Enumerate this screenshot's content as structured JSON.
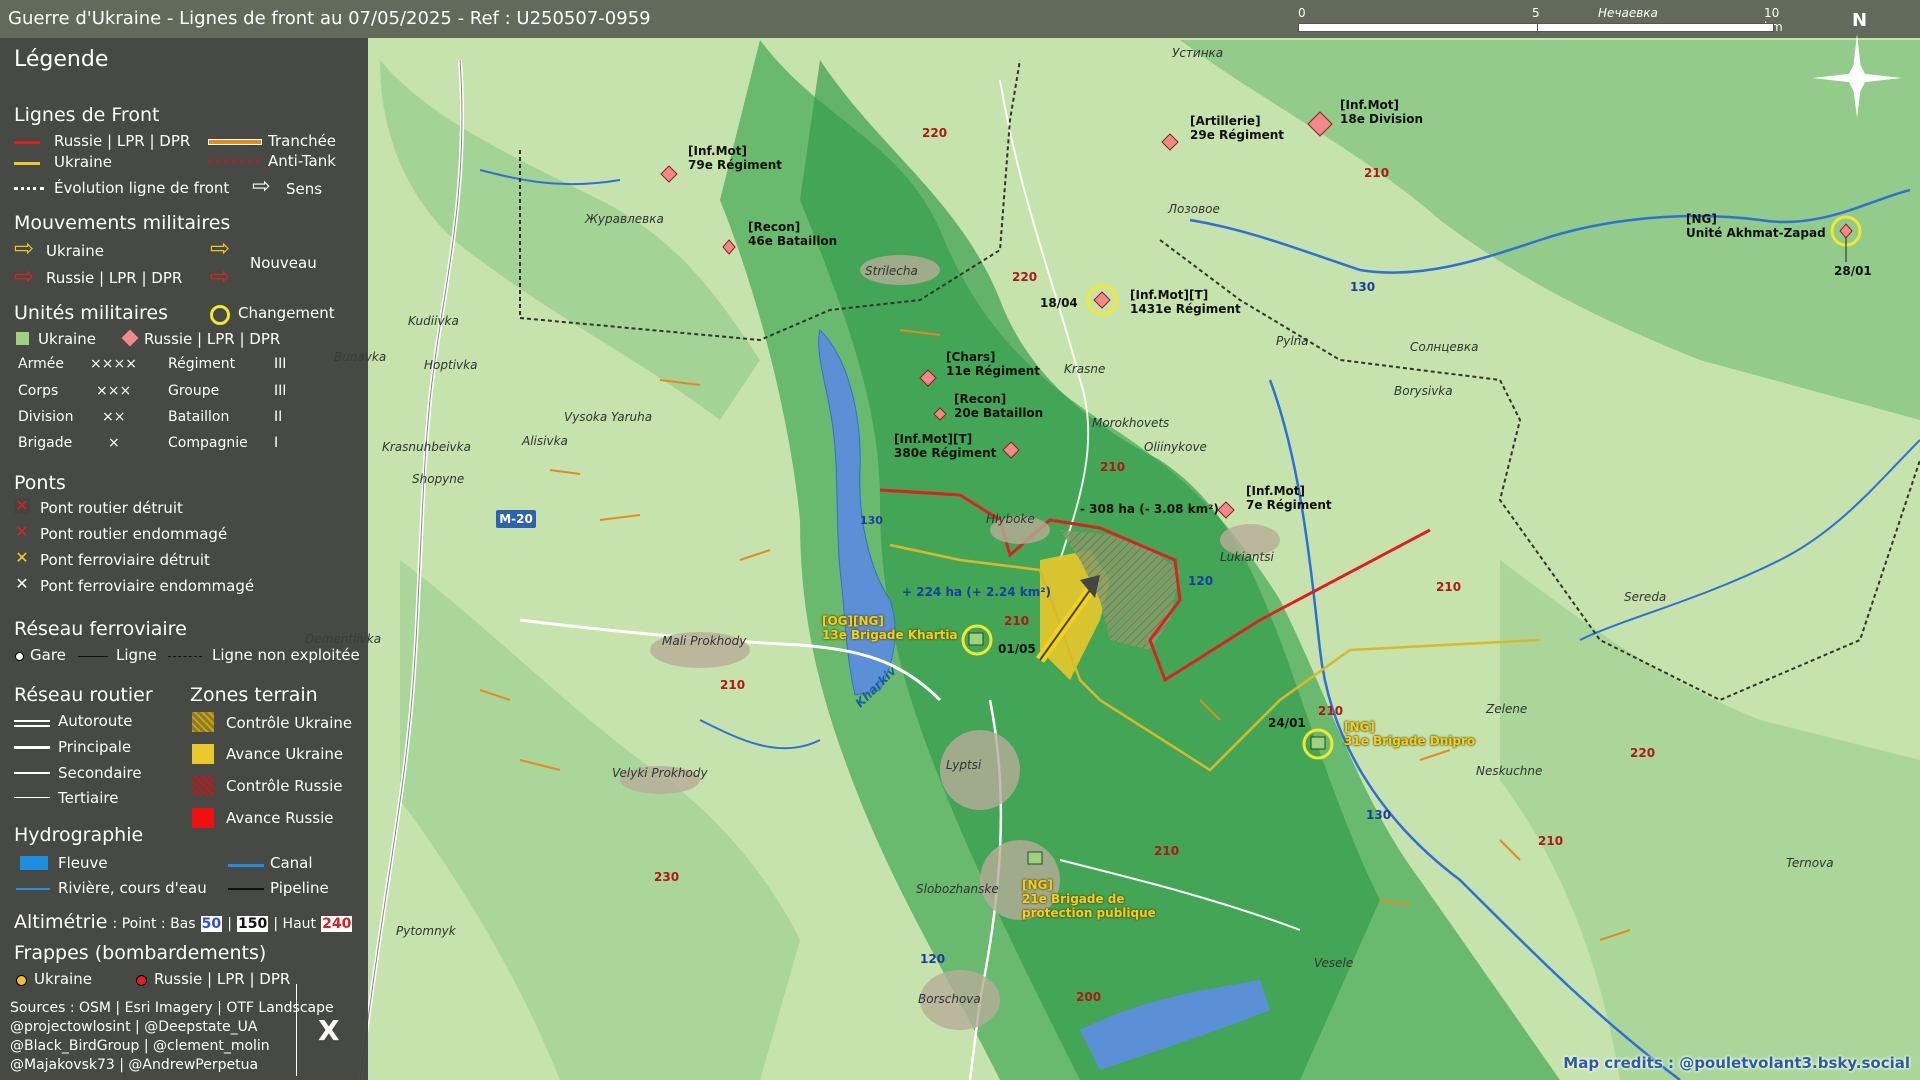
{
  "title": "Guerre d'Ukraine - Lignes de front au 07/05/2025 - Ref : U250507-0959",
  "scale": {
    "l0": "0",
    "l5": "5",
    "l10": "10 km",
    "place": "Нечаевка"
  },
  "north": "N",
  "legend": {
    "heading": "Légende",
    "front_lines": {
      "title": "Lignes de Front",
      "russia": "Russie | LPR | DPR",
      "ukraine": "Ukraine",
      "evolution": "Évolution ligne de front",
      "trench": "Tranchée",
      "antitank": "Anti-Tank",
      "direction": "Sens"
    },
    "movements": {
      "title": "Mouvements militaires",
      "ukraine": "Ukraine",
      "russia": "Russie | LPR | DPR",
      "new": "Nouveau"
    },
    "units": {
      "title": "Unités militaires",
      "change": "Changement",
      "ukraine": "Ukraine",
      "russia": "Russie | LPR | DPR",
      "rows": [
        {
          "a": "Armée",
          "as": "××××",
          "b": "Régiment",
          "bs": "III"
        },
        {
          "a": "Corps",
          "as": "×××",
          "b": "Groupe",
          "bs": "III"
        },
        {
          "a": "Division",
          "as": "××",
          "b": "Bataillon",
          "bs": "II"
        },
        {
          "a": "Brigade",
          "as": "×",
          "b": "Compagnie",
          "bs": "I"
        }
      ]
    },
    "bridges": {
      "title": "Ponts",
      "road_destroyed": "Pont routier détruit",
      "road_damaged": "Pont routier endommagé",
      "rail_destroyed": "Pont ferroviaire détruit",
      "rail_damaged": "Pont ferroviaire endommagé"
    },
    "rail": {
      "title": "Réseau ferroviaire",
      "station": "Gare",
      "line": "Ligne",
      "unused": "Ligne non exploitée"
    },
    "road": {
      "title": "Réseau routier",
      "motorway": "Autoroute",
      "main": "Principale",
      "secondary": "Secondaire",
      "tertiary": "Tertiaire"
    },
    "zones": {
      "title": "Zones terrain",
      "ua_control": "Contrôle Ukraine",
      "ua_advance": "Avance Ukraine",
      "ru_control": "Contrôle Russie",
      "ru_advance": "Avance Russie"
    },
    "hydro": {
      "title": "Hydrographie",
      "river": "Fleuve",
      "canal": "Canal",
      "stream": "Rivière, cours d'eau",
      "pipeline": "Pipeline"
    },
    "altimetry": {
      "title": "Altimétrie",
      "text": ": Point : Bas",
      "low": "50",
      "mid": "150",
      "sep1": "|",
      "sep2": "| Haut",
      "high": "240"
    },
    "strikes": {
      "title": "Frappes (bombardements)",
      "ukraine": "Ukraine",
      "russia": "Russie | LPR | DPR"
    },
    "sources": [
      "Sources : OSM | Esri Imagery | OTF Landscape",
      "@projectowlosint | @Deepstate_UA",
      "@Black_BirdGroup | @clement_molin",
      "@Majakovsk73 | @AndrewPerpetua"
    ],
    "x_logo": "X"
  },
  "places": [
    "Устинка",
    "Лозовое",
    "Журавлевка",
    "Strilecha",
    "Kudiivka",
    "Hoptivka",
    "Bunavka",
    "Krasne",
    "Pylna",
    "Солнцевка",
    "Borysivka",
    "Vysoka Yaruha",
    "Alisivka",
    "Krasnuhbeivka",
    "Shopyne",
    "Morokhovets",
    "Oliinykove",
    "Hlyboke",
    "Lukiantsi",
    "Sereda",
    "Mali Prokhody",
    "Zelene",
    "Neskuchne",
    "Velyki Prokhody",
    "Lyptsi",
    "Slobozhanske",
    "Pytomnyk",
    "Borschova",
    "Vesele",
    "Ternova",
    "Kharkiv",
    "Dementiivka"
  ],
  "altitudes": [
    "220",
    "210",
    "220",
    "130",
    "210",
    "120",
    "210",
    "210",
    "210",
    "210",
    "220",
    "210",
    "230",
    "210",
    "120",
    "200",
    "130"
  ],
  "units": [
    {
      "l1": "[Inf.Mot]",
      "l2": "79e Régiment",
      "echelon": "III"
    },
    {
      "l1": "[Recon]",
      "l2": "46e Bataillon",
      "echelon": "II"
    },
    {
      "l1": "[Artillerie]",
      "l2": "29e Régiment",
      "echelon": "III"
    },
    {
      "l1": "[Inf.Mot]",
      "l2": "18e Division",
      "echelon": "××"
    },
    {
      "l1": "[Inf.Mot][T]",
      "l2": "1431e Régiment",
      "echelon": "III",
      "date": "18/04"
    },
    {
      "l1": "[Chars]",
      "l2": "11e Régiment",
      "echelon": "III"
    },
    {
      "l1": "[Recon]",
      "l2": "20e Bataillon",
      "echelon": "II"
    },
    {
      "l1": "[Inf.Mot][T]",
      "l2": "380e Régiment",
      "echelon": "III"
    },
    {
      "l1": "[Inf.Mot]",
      "l2": "7e Régiment",
      "echelon": "III"
    },
    {
      "l1": "[NG]",
      "l2": "Unité Akhmat-Zapad",
      "echelon": "",
      "date": "28/01"
    }
  ],
  "ua_units": [
    {
      "l1": "[OG][NG]",
      "l2": "13e Brigade Khartia",
      "date": "01/05"
    },
    {
      "l1": "[NG]",
      "l2": "31e Brigade Dnipro",
      "date": "24/01"
    },
    {
      "l1": "[NG]",
      "l2": "21e Brigade de",
      "l3": "protection publique"
    }
  ],
  "annotations": {
    "ru_gain": "- 308 ha (- 3.08 km²)",
    "ua_gain": "+ 224 ha (+ 2.24 km²)"
  },
  "road_badge": "M-20",
  "credits": "Map credits : @pouletvolant3.bsky.social"
}
